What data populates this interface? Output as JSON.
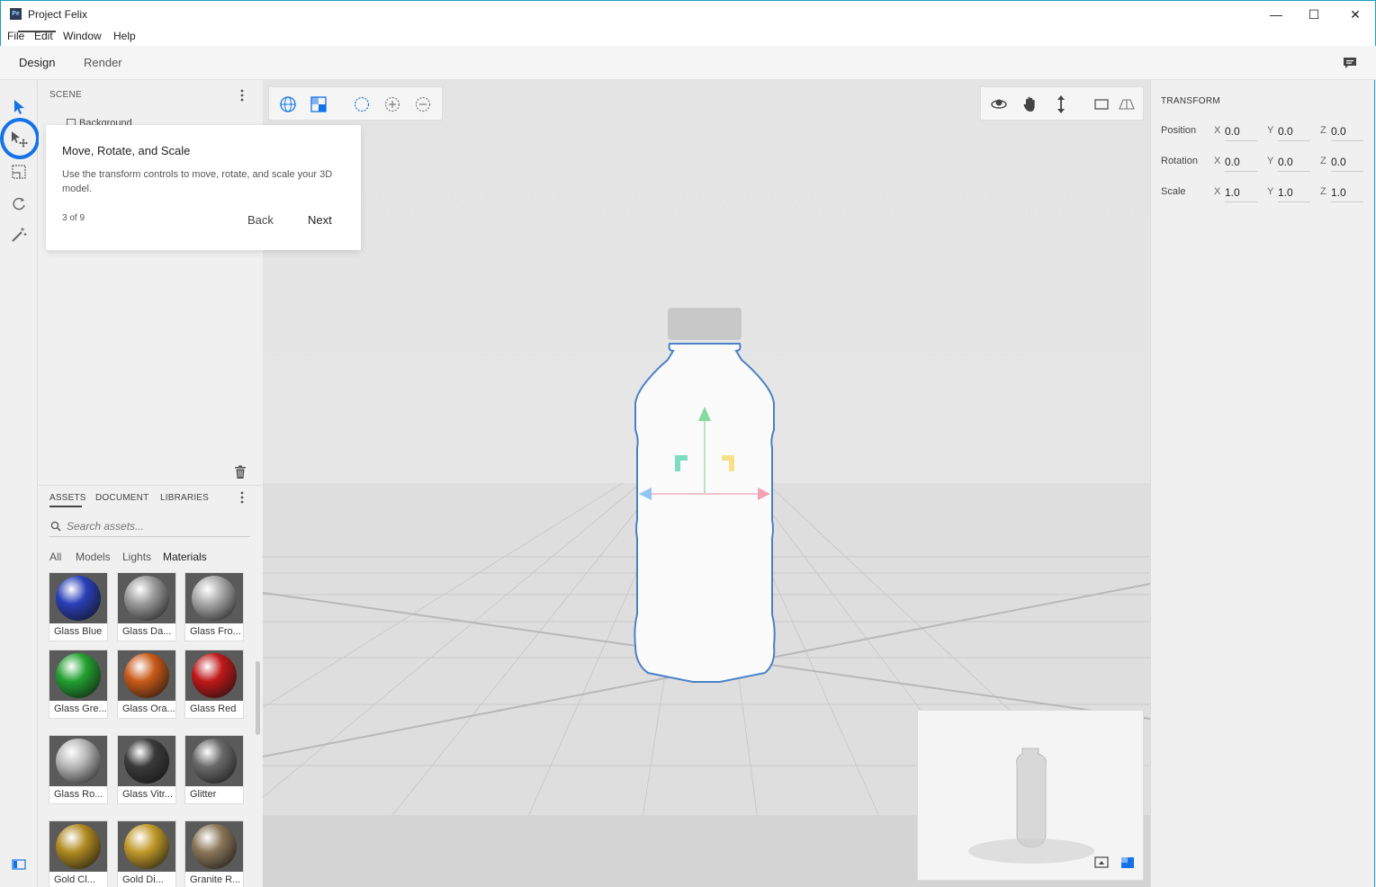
{
  "window": {
    "title": "Project Felix",
    "app_icon": "Pe",
    "minimize": "—",
    "maximize": "☐",
    "close": "✕"
  },
  "menu": [
    "File",
    "Edit",
    "Window",
    "Help"
  ],
  "modes": {
    "design": "Design",
    "render": "Render"
  },
  "scene": {
    "title": "SCENE",
    "items": [
      "Background"
    ]
  },
  "assets": {
    "tabs": [
      "ASSETS",
      "DOCUMENT",
      "LIBRARIES"
    ],
    "search_placeholder": "Search assets...",
    "filters": [
      "All",
      "Models",
      "Lights",
      "Materials"
    ],
    "materials": [
      {
        "label": "Glass Blue",
        "color": "#2a3fb8"
      },
      {
        "label": "Glass Da...",
        "color": "#9a9a9a"
      },
      {
        "label": "Glass Fro...",
        "color": "#a8a8a8"
      },
      {
        "label": "Glass Gre...",
        "color": "#22a030"
      },
      {
        "label": "Glass Ora...",
        "color": "#c85a18"
      },
      {
        "label": "Glass Red",
        "color": "#c01818"
      },
      {
        "label": "Glass Ro...",
        "color": "#b8b8b8"
      },
      {
        "label": "Glass Vitr...",
        "color": "#3a3a3a"
      },
      {
        "label": "Glitter",
        "color": "#6a6a6a"
      },
      {
        "label": "Gold Cl...",
        "color": "#b08a20"
      },
      {
        "label": "Gold Di...",
        "color": "#c29a2a"
      },
      {
        "label": "Granite R...",
        "color": "#8a7658"
      }
    ]
  },
  "tour": {
    "title": "Move, Rotate, and Scale",
    "body": "Use the transform controls to move, rotate, and scale your 3D model.",
    "step": "3 of 9",
    "back": "Back",
    "next": "Next"
  },
  "transform": {
    "title": "TRANSFORM",
    "rows": [
      {
        "label": "Position",
        "x": "0.0",
        "y": "0.0",
        "z": "0.0"
      },
      {
        "label": "Rotation",
        "x": "0.0",
        "y": "0.0",
        "z": "0.0"
      },
      {
        "label": "Scale",
        "x": "1.0",
        "y": "1.0",
        "z": "1.0"
      }
    ],
    "axes": [
      "X",
      "Y",
      "Z"
    ]
  },
  "colors": {
    "accent": "#1473e6",
    "frame": "#1a9fc0",
    "selection": "#4a80c8"
  }
}
